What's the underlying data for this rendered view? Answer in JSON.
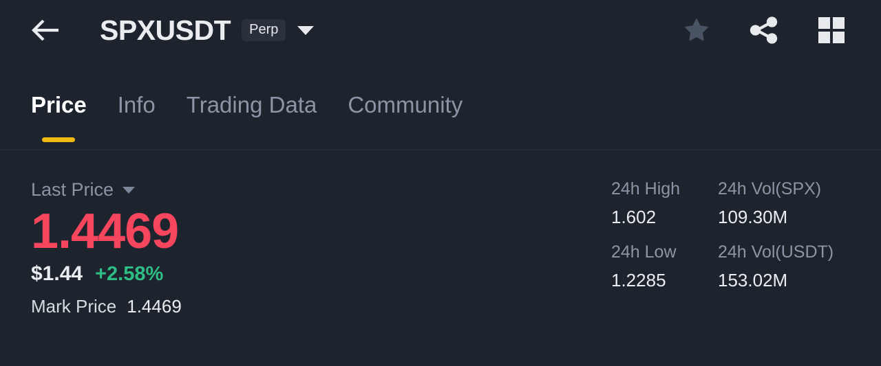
{
  "header": {
    "back_icon": "arrow-left-icon",
    "pair": "SPXUSDT",
    "contract_type": "Perp",
    "dropdown_icon": "chevron-down-icon",
    "actions": [
      {
        "name": "favorite",
        "icon": "star-icon"
      },
      {
        "name": "share",
        "icon": "share-icon"
      },
      {
        "name": "grid-menu",
        "icon": "grid-icon"
      }
    ]
  },
  "tabs": [
    {
      "label": "Price",
      "active": true
    },
    {
      "label": "Info",
      "active": false
    },
    {
      "label": "Trading Data",
      "active": false
    },
    {
      "label": "Community",
      "active": false
    }
  ],
  "price": {
    "label": "Last Price",
    "dropdown_icon": "caret-down-icon",
    "value": "1.4469",
    "usd_value": "$1.44",
    "change_pct": "+2.58%",
    "mark_price_label": "Mark Price",
    "mark_price_value": "1.4469"
  },
  "stats": [
    {
      "label": "24h High",
      "value": "1.602"
    },
    {
      "label": "24h Vol(SPX)",
      "value": "109.30M"
    },
    {
      "label": "24h Low",
      "value": "1.2285"
    },
    {
      "label": "24h Vol(USDT)",
      "value": "153.02M"
    }
  ],
  "colors": {
    "background": "#1e242e",
    "accent": "#f0b90b",
    "down": "#f6465d",
    "up": "#2ebd85",
    "text_primary": "#eaecef",
    "text_muted": "#8b95a5"
  }
}
